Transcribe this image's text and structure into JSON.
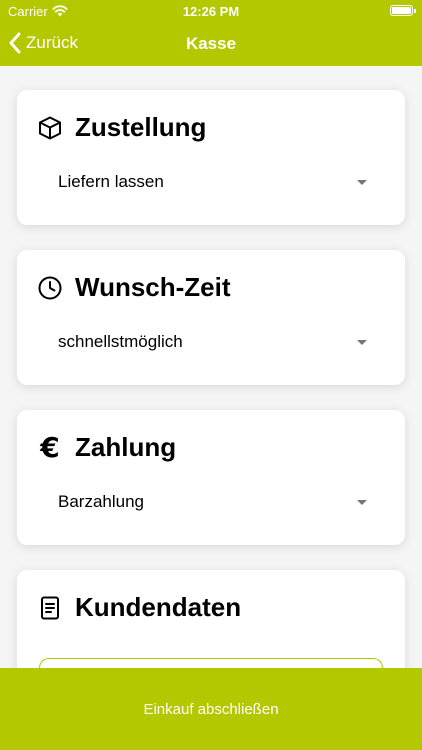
{
  "status_bar": {
    "carrier": "Carrier",
    "time": "12:26 PM"
  },
  "nav": {
    "back_label": "Zurück",
    "title": "Kasse"
  },
  "sections": {
    "delivery": {
      "title": "Zustellung",
      "value": "Liefern lassen",
      "icon": "box-icon"
    },
    "time": {
      "title": "Wunsch-Zeit",
      "value": "schnellstmöglich",
      "icon": "clock-icon"
    },
    "payment": {
      "title": "Zahlung",
      "value": "Barzahlung",
      "icon": "euro-icon"
    },
    "customer": {
      "title": "Kundendaten",
      "icon": "document-icon"
    }
  },
  "footer": {
    "button_label": "Einkauf abschließen"
  },
  "colors": {
    "accent": "#b4c800",
    "background": "#f5f5f5"
  }
}
